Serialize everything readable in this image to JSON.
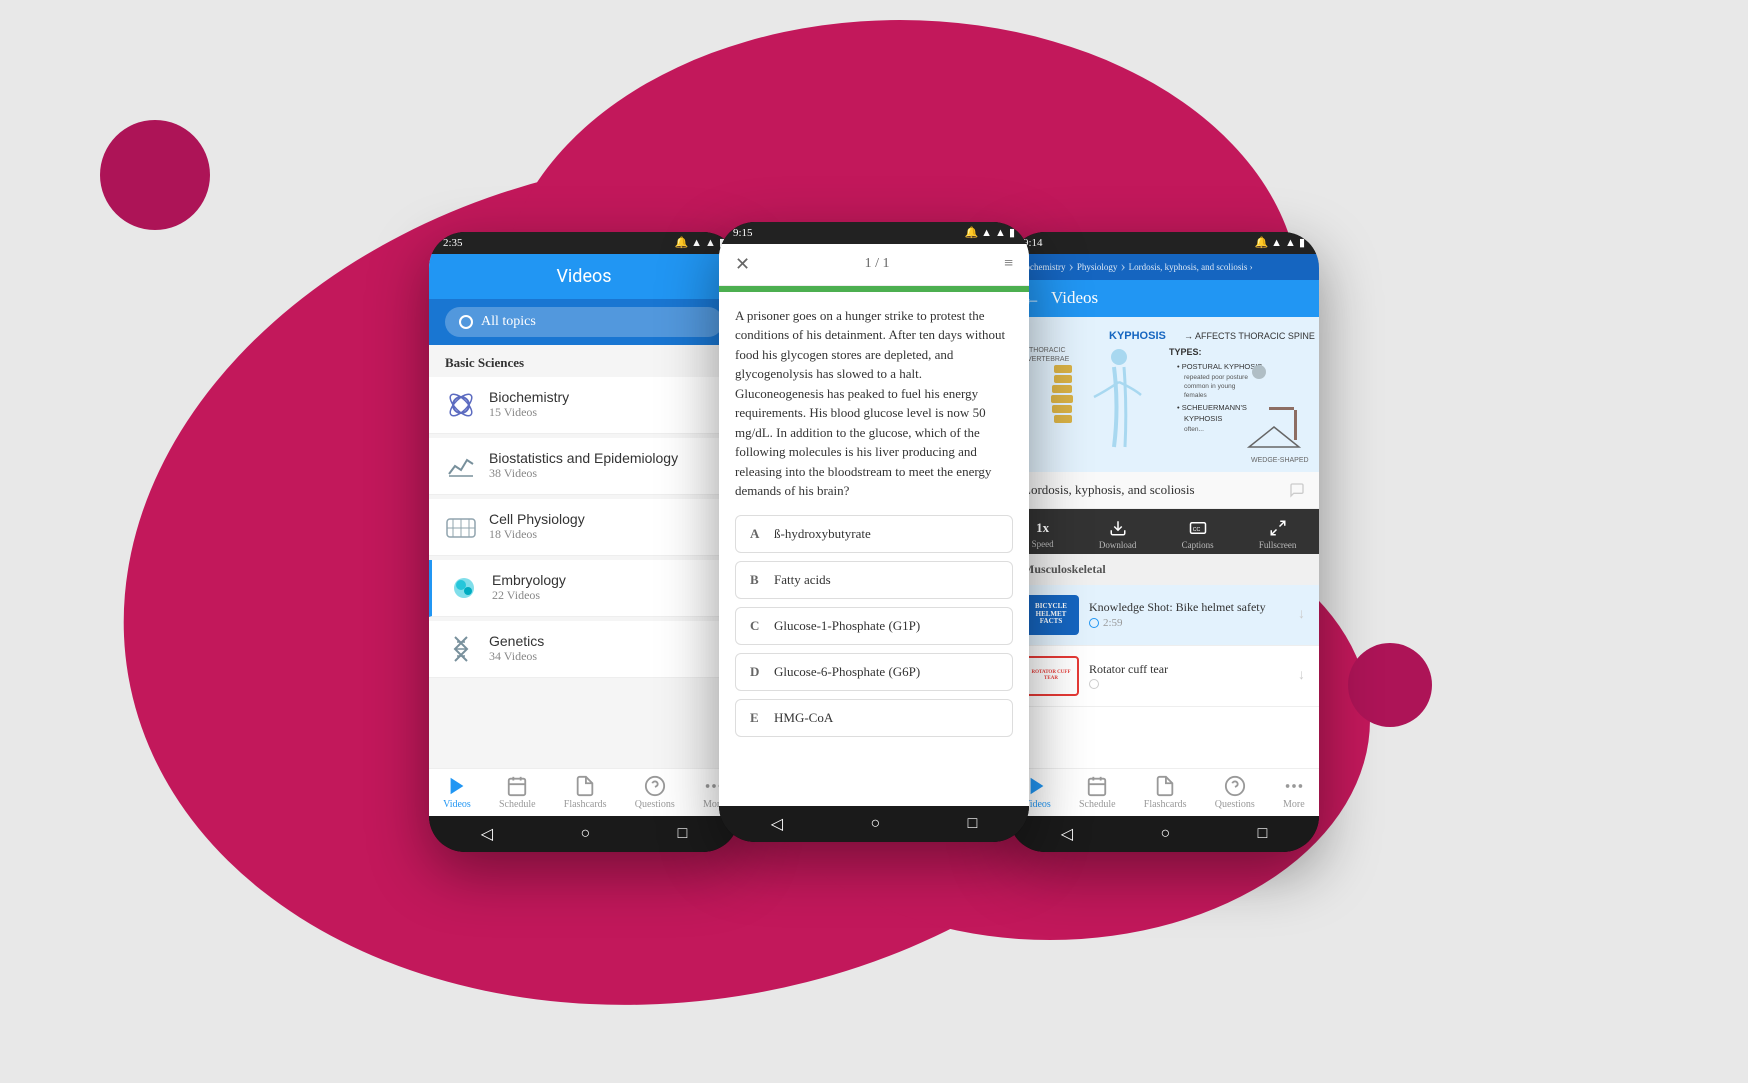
{
  "background": {
    "color": "#d81b60"
  },
  "phone1": {
    "status_time": "2:35",
    "header_title": "Videos",
    "search_placeholder": "All topics",
    "section_label": "Basic Sciences",
    "topics": [
      {
        "name": "Biochemistry",
        "count": "15 Videos",
        "icon": "biochem"
      },
      {
        "name": "Biostatistics and Epidemiology",
        "count": "38 Videos",
        "icon": "biostats"
      },
      {
        "name": "Cell Physiology",
        "count": "18 Videos",
        "icon": "cell"
      },
      {
        "name": "Embryology",
        "count": "22 Videos",
        "icon": "embryo",
        "active": true
      },
      {
        "name": "Genetics",
        "count": "34 Videos",
        "icon": "genetics"
      }
    ],
    "nav": [
      {
        "label": "Videos",
        "active": true
      },
      {
        "label": "Schedule"
      },
      {
        "label": "Flashcards"
      },
      {
        "label": "Questions"
      },
      {
        "label": "More"
      }
    ]
  },
  "phone2": {
    "status_time": "9:15",
    "counter": "1 / 1",
    "question": "A prisoner goes on a hunger strike to protest the conditions of his detainment. After ten days without food his glycogen stores are depleted, and glycogenolysis has slowed to a halt. Gluconeogenesis has peaked to fuel his energy requirements. His blood glucose level is now 50 mg/dL. In addition to the glucose, which of the following molecules is his liver producing and releasing into the bloodstream to meet the energy demands of his brain?",
    "answers": [
      {
        "letter": "A",
        "text": "ß-hydroxybutyrate"
      },
      {
        "letter": "B",
        "text": "Fatty acids"
      },
      {
        "letter": "C",
        "text": "Glucose-1-Phosphate (G1P)"
      },
      {
        "letter": "D",
        "text": "Glucose-6-Phosphate (G6P)"
      },
      {
        "letter": "E",
        "text": "HMG-CoA"
      }
    ]
  },
  "phone3": {
    "status_time": "9:14",
    "breadcrumbs": [
      "Biochemistry",
      "Physiology",
      "Lordosis, kyphosis, and scoliosis"
    ],
    "header_title": "Videos",
    "video_title": "Lordosis, kyphosis, and scoliosis",
    "controls": [
      {
        "label": "Speed",
        "value": "1x"
      },
      {
        "label": "Download"
      },
      {
        "label": "Captions"
      },
      {
        "label": "Fullscreen"
      }
    ],
    "section_header": "Musculoskeletal",
    "video_items": [
      {
        "thumb_type": "bike",
        "thumb_text": "BICYCLE HELMET FACTS",
        "name": "Knowledge Shot: Bike helmet safety",
        "duration": "2:59",
        "has_circle": true
      },
      {
        "thumb_type": "rotator",
        "thumb_text": "ROTATOR CUFF TEAR",
        "name": "Rotator cuff tear",
        "duration": "",
        "has_circle": false
      }
    ],
    "nav": [
      {
        "label": "Videos",
        "active": true
      },
      {
        "label": "Schedule"
      },
      {
        "label": "Flashcards"
      },
      {
        "label": "Questions"
      },
      {
        "label": "More"
      }
    ]
  }
}
